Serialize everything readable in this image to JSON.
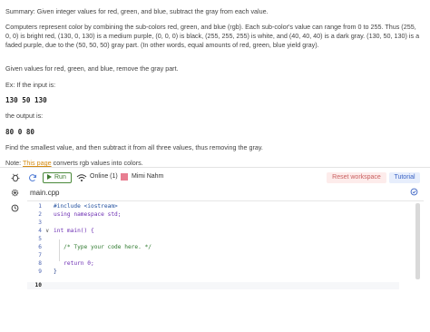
{
  "problem": {
    "summary": "Summary: Given integer values for red, green, and blue, subtract the gray from each value.",
    "body": "Computers represent color by combining the sub-colors red, green, and blue (rgb). Each sub-color's value can range from 0 to 255. Thus (255, 0, 0) is bright red, (130, 0, 130) is a medium purple, (0, 0, 0) is black, (255, 255, 255) is white, and (40, 40, 40) is a dark gray. (130, 50, 130) is a faded purple, due to the (50, 50, 50) gray part. (In other words, equal amounts of red, green, blue yield gray).",
    "given": "Given values for red, green, and blue, remove the gray part.",
    "ex_label": "Ex: If the input is:",
    "input_example": "130 50 130",
    "output_label": "the output is:",
    "output_example": "80 0 80",
    "find": "Find the smallest value, and then subtract it from all three values, thus removing the gray.",
    "note_prefix": "Note: ",
    "note_link": "This page",
    "note_suffix": " converts rgb values into colors."
  },
  "toolbar": {
    "run_label": "Run",
    "online_label": "Online (1)",
    "user_name": "Mimi Nahm",
    "user_color": "#e87e91",
    "reset_label": "Reset workspace",
    "tutorial_label": "Tutorial"
  },
  "editor": {
    "file_name": "main.cpp",
    "line_numbers": [
      "1",
      "2",
      "3",
      "4",
      "5",
      "6",
      "7",
      "8",
      "9",
      "10"
    ],
    "lines": [
      "#include <iostream>",
      "using namespace std;",
      "",
      "int main() {",
      "",
      "   /* Type your code here. */",
      "",
      "   return 0;",
      "}",
      ""
    ]
  },
  "icons": [
    "bug-icon",
    "refresh-icon",
    "wifi-icon",
    "gear-icon",
    "clock-icon",
    "check-circle-icon"
  ],
  "colors": {
    "run": "#3d7a2e",
    "link": "#d58b12",
    "reset": "#c96060",
    "tutorial": "#3b63c4"
  }
}
